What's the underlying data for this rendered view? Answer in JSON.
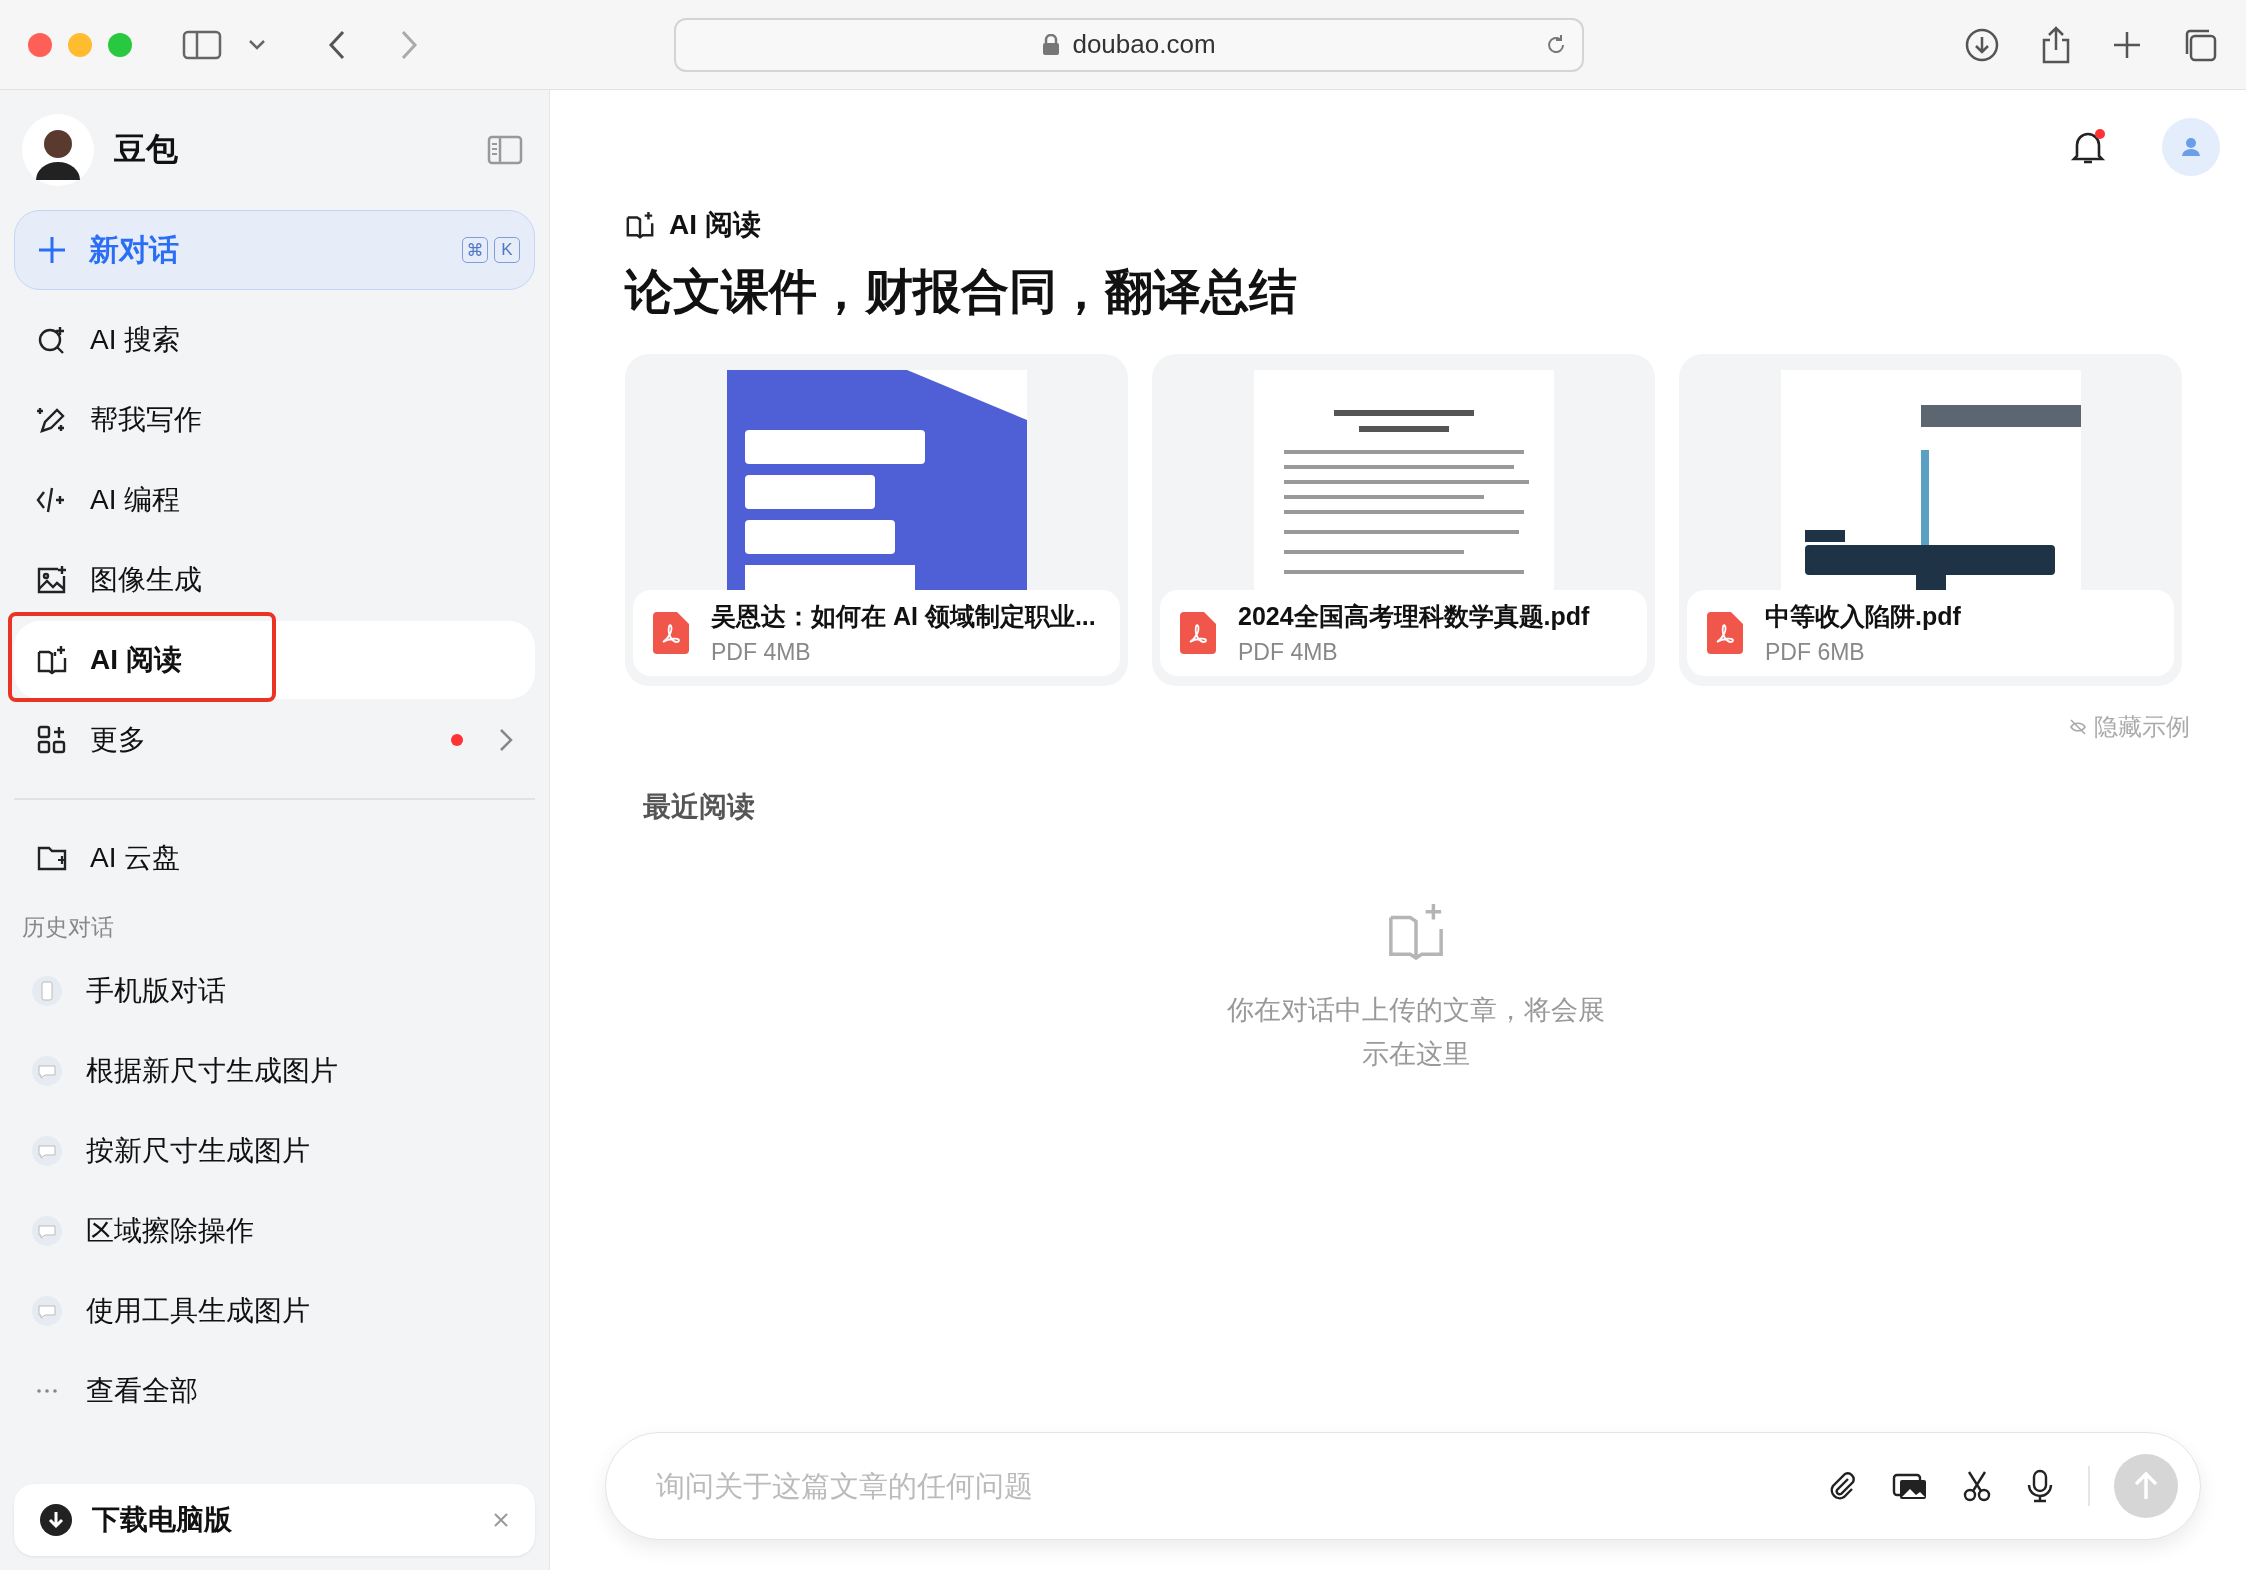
{
  "browser": {
    "url": "doubao.com"
  },
  "sidebar": {
    "app_name": "豆包",
    "new_chat": {
      "label": "新对话",
      "shortcut": [
        "⌘",
        "K"
      ]
    },
    "nav": [
      {
        "label": "AI 搜索",
        "selected": false,
        "highlighted": false,
        "badge": false
      },
      {
        "label": "帮我写作",
        "selected": false,
        "highlighted": false,
        "badge": false
      },
      {
        "label": "AI 编程",
        "selected": false,
        "highlighted": false,
        "badge": false
      },
      {
        "label": "图像生成",
        "selected": false,
        "highlighted": false,
        "badge": false
      },
      {
        "label": "AI 阅读",
        "selected": true,
        "highlighted": true,
        "badge": false
      },
      {
        "label": "更多",
        "selected": false,
        "highlighted": false,
        "badge": true
      }
    ],
    "cloud": "AI 云盘",
    "history_title": "历史对话",
    "history": [
      {
        "label": "手机版对话",
        "kind": "phone"
      },
      {
        "label": "根据新尺寸生成图片",
        "kind": "chat"
      },
      {
        "label": "按新尺寸生成图片",
        "kind": "chat"
      },
      {
        "label": "区域擦除操作",
        "kind": "chat"
      },
      {
        "label": "使用工具生成图片",
        "kind": "chat"
      }
    ],
    "view_all": "查看全部",
    "download": "下载电脑版"
  },
  "main": {
    "section_label": "AI 阅读",
    "headline": "论文课件，财报合同，翻译总结",
    "docs": [
      {
        "title": "吴恩达：如何在 AI 领域制定职业...",
        "meta": "PDF 4MB"
      },
      {
        "title": "2024全国高考理科数学真题.pdf",
        "meta": "PDF 4MB"
      },
      {
        "title": "中等收入陷阱.pdf",
        "meta": "PDF 6MB"
      }
    ],
    "hide_examples": "隐藏示例",
    "recent_title": "最近阅读",
    "empty_text": "你在对话中上传的文章，将会展示在这里",
    "input": {
      "placeholder": "询问关于这篇文章的任何问题"
    }
  }
}
